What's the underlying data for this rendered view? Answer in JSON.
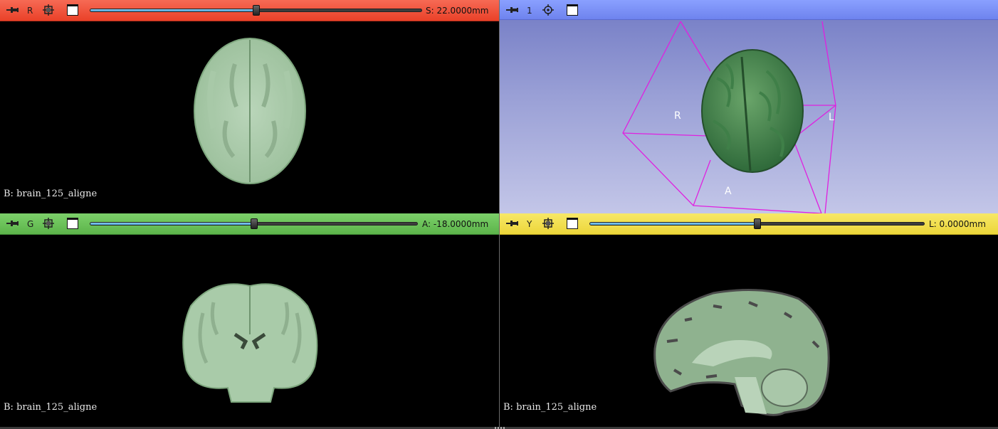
{
  "views": {
    "red": {
      "label": "R",
      "slice_value": "S: 22.0000mm",
      "slider_position_fraction": 0.5,
      "background_volume": "B: brain_125_aligne",
      "color": "#ea4128"
    },
    "threed": {
      "label": "1",
      "orientation_labels": {
        "right": "R",
        "left": "L",
        "anterior": "A"
      },
      "color": "#6e83ee"
    },
    "green": {
      "label": "G",
      "slice_value": "A: -18.0000mm",
      "slider_position_fraction": 0.5,
      "background_volume": "B: brain_125_aligne",
      "color": "#5cb44a"
    },
    "yellow": {
      "label": "Y",
      "slice_value": "L: 0.0000mm",
      "slider_position_fraction": 0.5,
      "background_volume": "B: brain_125_aligne",
      "color": "#ecd63a"
    }
  },
  "icons": {
    "pin": "pin-icon",
    "link": "link-icon",
    "view_options": "window-icon",
    "center": "center-3d-icon"
  }
}
